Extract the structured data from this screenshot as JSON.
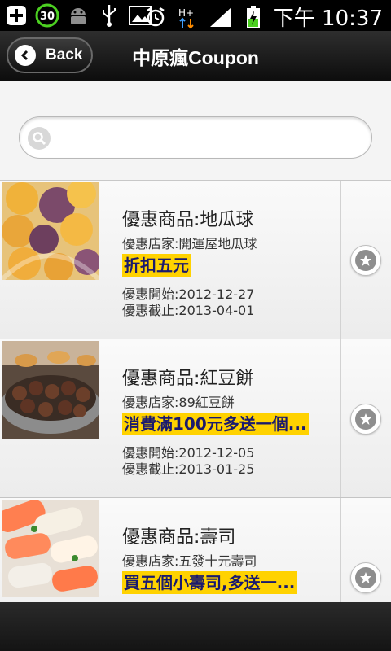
{
  "statusbar": {
    "battery_badge": "30",
    "time": "下午 10:37",
    "network": "H+"
  },
  "header": {
    "back_label": "Back",
    "title": "中原瘋Coupon"
  },
  "search": {
    "value": "",
    "placeholder": ""
  },
  "coupons": [
    {
      "product": "優惠商品:地瓜球",
      "shop": "優惠店家:開運屋地瓜球",
      "deal": "折扣五元",
      "start": "優惠開始:2012-12-27",
      "end": "優惠截止:2013-04-01",
      "image": "sweet-potato-balls"
    },
    {
      "product": "優惠商品:紅豆餅",
      "shop": "優惠店家:89紅豆餅",
      "deal": "消費滿100元多送一個...",
      "start": "優惠開始:2012-12-05",
      "end": "優惠截止:2013-01-25",
      "image": "red-bean-cakes"
    },
    {
      "product": "優惠商品:壽司",
      "shop": "優惠店家:五發十元壽司",
      "deal": "買五個小壽司,多送一...",
      "start": "",
      "end": "",
      "image": "sushi"
    }
  ],
  "colors": {
    "highlight": "#ffd200",
    "deal_text": "#1a1a6e",
    "titlebar": "#1a1a1a"
  }
}
